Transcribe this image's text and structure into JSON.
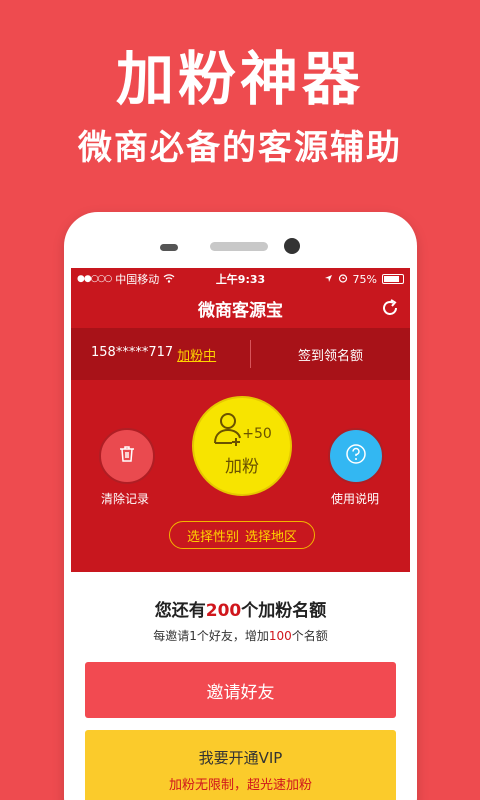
{
  "promo": {
    "title": "加粉神器",
    "subtitle": "微商必备的客源辅助"
  },
  "status_bar": {
    "carrier": "中国移动",
    "signal": "●●○○○",
    "time": "上午9:33",
    "battery": "75%"
  },
  "nav": {
    "title": "微商客源宝"
  },
  "account": {
    "phone": "158*****717",
    "status": "加粉中",
    "signin": "签到领名额"
  },
  "actions": {
    "clear_label": "清除记录",
    "add_label": "加粉",
    "add_count": "+50",
    "help_label": "使用说明",
    "filter_gender": "选择性别",
    "filter_region": "选择地区"
  },
  "quota": {
    "prefix": "您还有",
    "count": "200",
    "suffix": "个加粉名额",
    "invite_prefix": "每邀请1个好友，增加",
    "invite_count": "100",
    "invite_suffix": "个名额"
  },
  "invite_button": "邀请好友",
  "vip": {
    "title": "我要开通VIP",
    "desc": "加粉无限制，超光速加粉"
  },
  "colors": {
    "background": "#ee4b4f",
    "header_red": "#c8171e",
    "accent_yellow": "#f7e400",
    "help_blue": "#33b7f2"
  }
}
